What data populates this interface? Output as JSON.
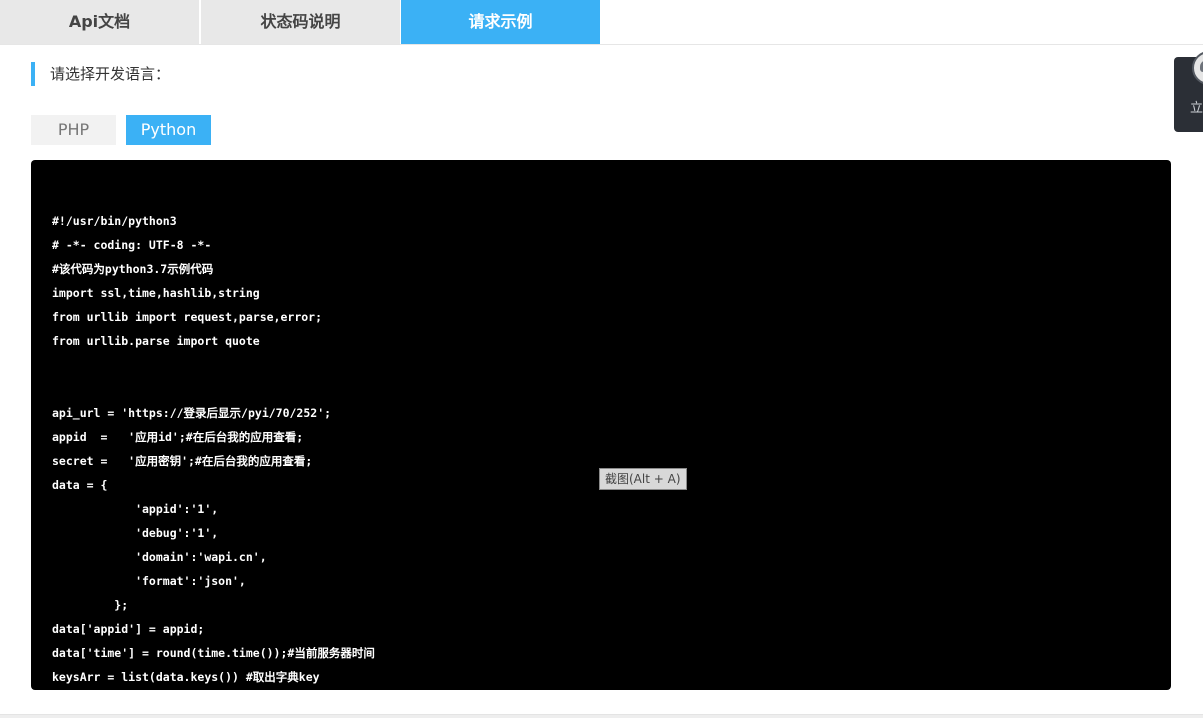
{
  "tabs": [
    {
      "label": "Api文档"
    },
    {
      "label": "状态码说明"
    },
    {
      "label": "请求示例",
      "active": true
    }
  ],
  "language_section": {
    "heading": "请选择开发语言：",
    "options": [
      {
        "label": "PHP",
        "active": false
      },
      {
        "label": "Python",
        "active": true
      }
    ]
  },
  "code": {
    "lines": [
      "#!/usr/bin/python3",
      "# -*- coding: UTF-8 -*-",
      "#该代码为python3.7示例代码",
      "import ssl,time,hashlib,string",
      "from urllib import request,parse,error;",
      "from urllib.parse import quote",
      "api_url = 'https://登录后显示/pyi/70/252';",
      "appid  =   '应用id';#在后台我的应用查看;",
      "secret =   '应用密钥';#在后台我的应用查看;",
      "data = {",
      "            'appid':'1',",
      "            'debug':'1',",
      "            'domain':'wapi.cn',",
      "            'format':'json',",
      "         };",
      "data['appid'] = appid;",
      "data['time'] = round(time.time());#当前服务器时间",
      "keysArr = list(data.keys()) #取出字典key"
    ]
  },
  "screenshot_hint": "截图(Alt + A)",
  "float_widget": {
    "label": "立",
    "icon": "user-avatar-icon"
  },
  "colors": {
    "accent": "#3bb1f5",
    "code_bg": "#000000",
    "tab_inactive_bg": "#e8e8e8"
  }
}
